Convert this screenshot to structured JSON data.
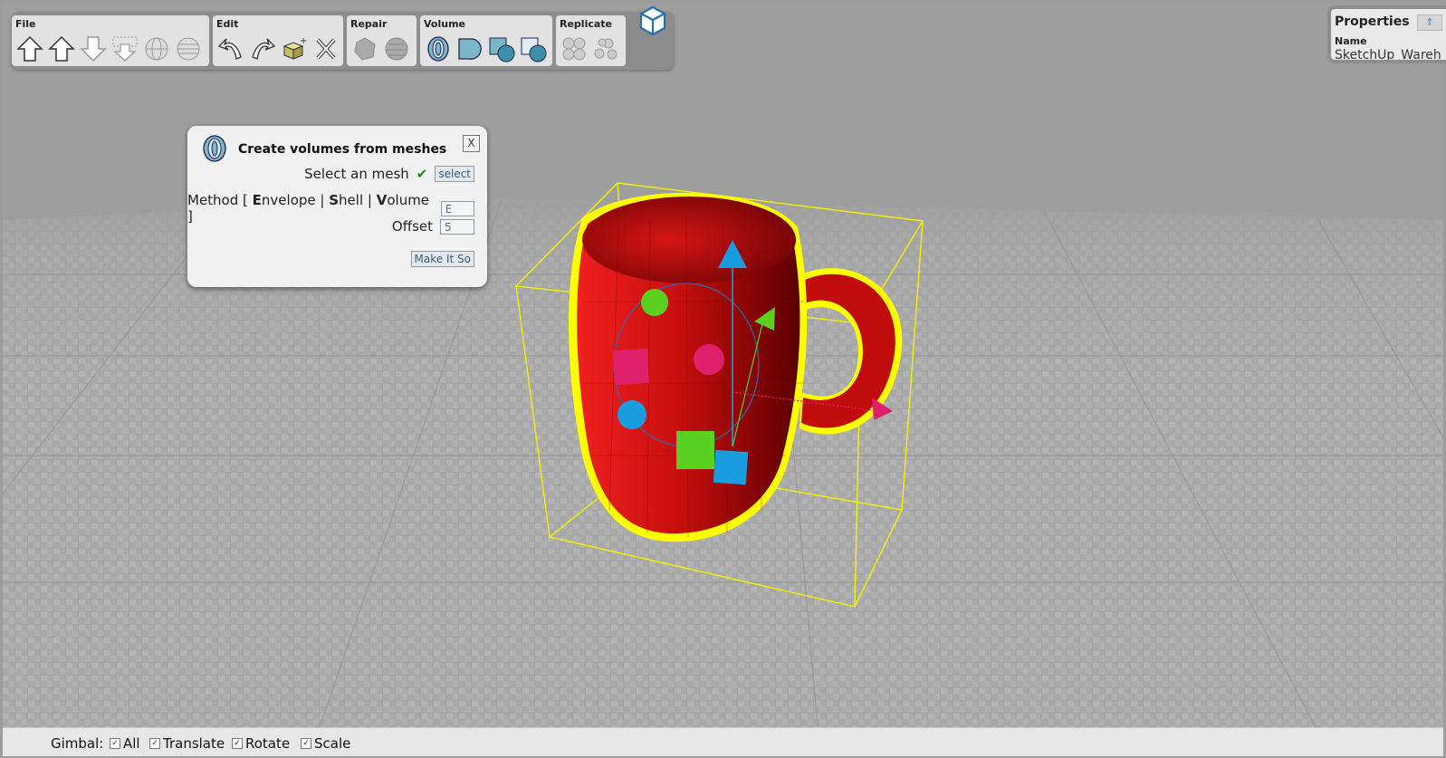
{
  "toolbar": {
    "groups": [
      {
        "label": "File",
        "icons": [
          "upload-arrow-icon",
          "upload-arrow-icon",
          "download-arrow-icon",
          "download-selection-icon",
          "sphere-wire-icon",
          "sphere-stack-icon"
        ]
      },
      {
        "label": "Edit",
        "icons": [
          "undo-icon",
          "redo-icon",
          "duplicate-icon",
          "delete-icon"
        ]
      },
      {
        "label": "Repair",
        "icons": [
          "repair-shape-icon",
          "repair-sphere-icon"
        ]
      },
      {
        "label": "Volume",
        "icons": [
          "volume-mesh-icon",
          "volume-shape-icon",
          "volume-union-icon",
          "volume-subtract-icon"
        ]
      },
      {
        "label": "Replicate",
        "icons": [
          "replicate-grid-icon",
          "replicate-scatter-icon"
        ]
      }
    ]
  },
  "properties": {
    "title": "Properties",
    "pin": "⇑",
    "name_label": "Name",
    "name_value": "SketchUp_Wareh"
  },
  "dialog": {
    "title": "Create volumes from meshes",
    "close": "X",
    "select_label": "Select an mesh",
    "check": "✔",
    "select_button": "select",
    "method_label_pre": "Method [",
    "method_e": "E",
    "method_e_rest": "nvelope |",
    "method_s": "S",
    "method_s_rest": "hell |",
    "method_v": "V",
    "method_v_rest": "olume ]",
    "method_value": "E",
    "offset_label": "Offset",
    "offset_value": "5",
    "submit": "Make It So"
  },
  "status": {
    "gimbal_label": "Gimbal:",
    "options": [
      {
        "label": "All",
        "checked": true
      },
      {
        "label": "Translate",
        "checked": true
      },
      {
        "label": "Rotate",
        "checked": true
      },
      {
        "label": "Scale",
        "checked": true
      }
    ]
  },
  "colors": {
    "mug": "#d11212",
    "selection": "#ffff00",
    "gizmo_blue": "#1a9de0",
    "gizmo_green": "#5ad020",
    "gizmo_pink": "#e0206a"
  }
}
